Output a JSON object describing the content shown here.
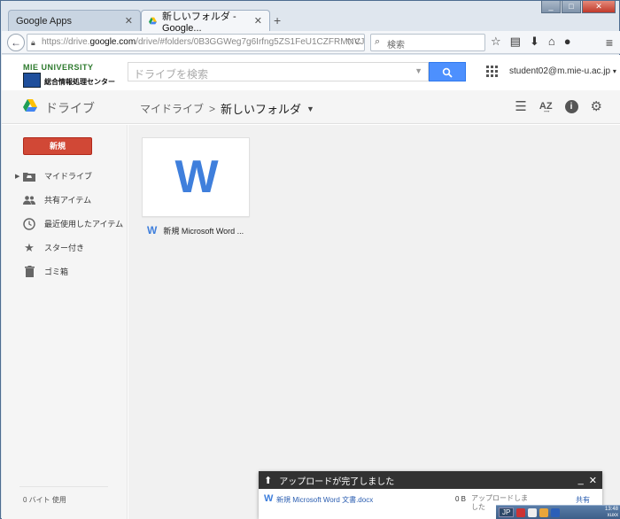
{
  "browser": {
    "tabs": [
      {
        "label": "Google Apps",
        "active": false
      },
      {
        "label": "新しいフォルダ - Google...",
        "active": true
      }
    ],
    "new_tab": "+",
    "url_prefix": "https://drive.",
    "url_domain": "google.com",
    "url_path": "/drive/#folders/0B3GGWeg7g6Irfng5ZS1FeU1CZFRMNVJpL",
    "search_placeholder": "検索",
    "window_controls": {
      "minimize": "_",
      "maximize": "□",
      "close": "✕"
    }
  },
  "header": {
    "logo_top": "MIE UNIVERSITY",
    "logo_name": "総合情報処理センター",
    "search_placeholder": "ドライブを検索",
    "account": "student02@m.mie-u.ac.jp"
  },
  "drivebar": {
    "app_label": "ドライブ",
    "breadcrumb_root": "マイドライブ",
    "breadcrumb_sep": ">",
    "current_folder": "新しいフォルダ"
  },
  "sidebar": {
    "new_button": "新規",
    "items": [
      {
        "label": "マイドライブ",
        "icon": "drive-folder-icon"
      },
      {
        "label": "共有アイテム",
        "icon": "people-icon"
      },
      {
        "label": "最近使用したアイテム",
        "icon": "clock-icon"
      },
      {
        "label": "スター付き",
        "icon": "star-icon"
      },
      {
        "label": "ゴミ箱",
        "icon": "trash-icon"
      }
    ],
    "quota": "0 バイト 使用"
  },
  "files": [
    {
      "name": "新規 Microsoft Word ...",
      "icon_letter": "W"
    }
  ],
  "upload": {
    "title": "アップロードが完了しました",
    "file": "新規 Microsoft Word 文書.docx",
    "size": "0 B",
    "status": "アップロードしました",
    "share": "共有"
  },
  "tray": {
    "ime": "JP",
    "clock": "13:48\nxuxx"
  },
  "colors": {
    "accent_blue": "#4d90fe",
    "new_button_red": "#d14836",
    "word_blue": "#3f7fdc"
  }
}
